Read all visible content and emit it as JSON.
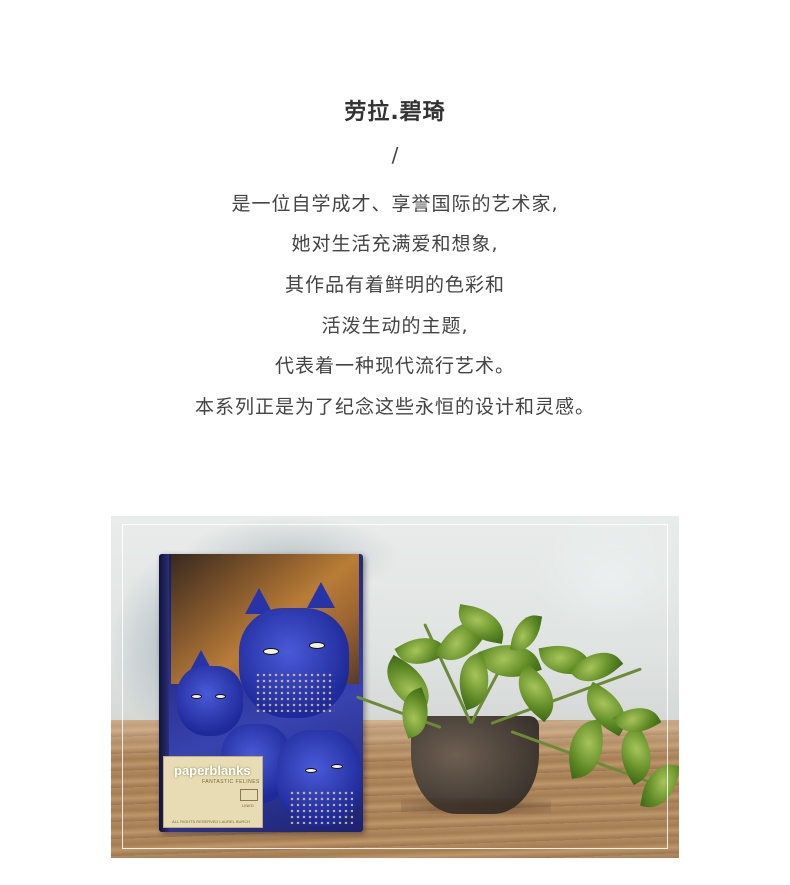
{
  "heading": {
    "title": "劳拉.碧琦",
    "divider": "/"
  },
  "description": {
    "lines": [
      "是一位自学成才、享誉国际的艺术家,",
      "她对生活充满爱和想象,",
      "其作品有着鲜明的色彩和",
      "活泼生动的主题,",
      "代表着一种现代流行艺术。",
      "本系列正是为了纪念这些永恒的设计和灵感。"
    ]
  },
  "product_photo": {
    "notebook_brand": "paperblanks",
    "notebook_subtitle": "FANTASTIC FELINES",
    "notebook_ruling": "LINED",
    "notebook_footer": "ALL RIGHTS RESERVED LAUREL BURCH"
  }
}
